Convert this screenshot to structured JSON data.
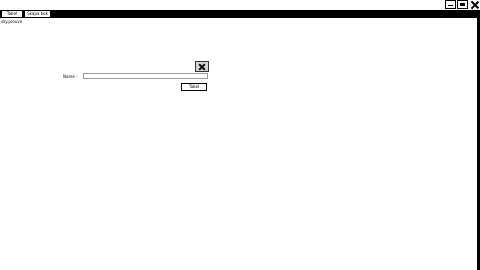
{
  "tabs": [
    {
      "label": "Tabel"
    },
    {
      "label": "Skapa bok"
    }
  ],
  "page_label": "sky.prouvo",
  "form": {
    "name_label": "Name :",
    "name_value": "",
    "save_label": "Tabel"
  },
  "icons": {
    "minimize": "minimize-icon",
    "maximize": "maximize-icon",
    "close": "close-icon",
    "dialog_close": "close-icon"
  }
}
